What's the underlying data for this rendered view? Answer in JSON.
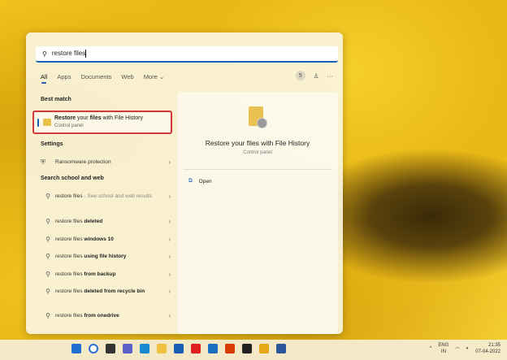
{
  "search": {
    "query": "restore files"
  },
  "tabs": [
    "All",
    "Apps",
    "Documents",
    "Web",
    "More"
  ],
  "tools": {
    "badge": "5"
  },
  "best_match": {
    "heading": "Best match",
    "title_bold1": "Restore",
    "title_mid": " your ",
    "title_bold2": "files",
    "title_end": " with File History",
    "subtitle": "Control panel"
  },
  "settings": {
    "heading": "Settings",
    "items": [
      {
        "label": "Ransomware protection"
      }
    ]
  },
  "web": {
    "heading": "Search school and web",
    "first": {
      "prefix": "restore files",
      "suffix": " - See school and web results"
    },
    "items": [
      {
        "prefix": "restore files ",
        "bold": "deleted"
      },
      {
        "prefix": "restore files ",
        "bold": "windows 10"
      },
      {
        "prefix": "restore files ",
        "bold": "using file history"
      },
      {
        "prefix": "restore files ",
        "bold": "from backup"
      },
      {
        "prefix": "restore files ",
        "bold": "deleted from recycle bin"
      },
      {
        "prefix": "restore files ",
        "bold": "from onedrive"
      }
    ]
  },
  "preview": {
    "title": "Restore your files with File History",
    "subtitle": "Control panel",
    "action": "Open"
  },
  "tray": {
    "lang1": "ENG",
    "lang2": "IN",
    "time": "21:35",
    "date": "07-04-2022"
  },
  "taskbar_colors": [
    "#1f6fd0",
    "#2a6fd6",
    "#333",
    "#5b5fc7",
    "#1a8ad0",
    "#f0c040",
    "#1a5fb4",
    "#e02020",
    "#1a6fc0",
    "#d83b01",
    "#222",
    "#e6a817",
    "#2b579a"
  ]
}
